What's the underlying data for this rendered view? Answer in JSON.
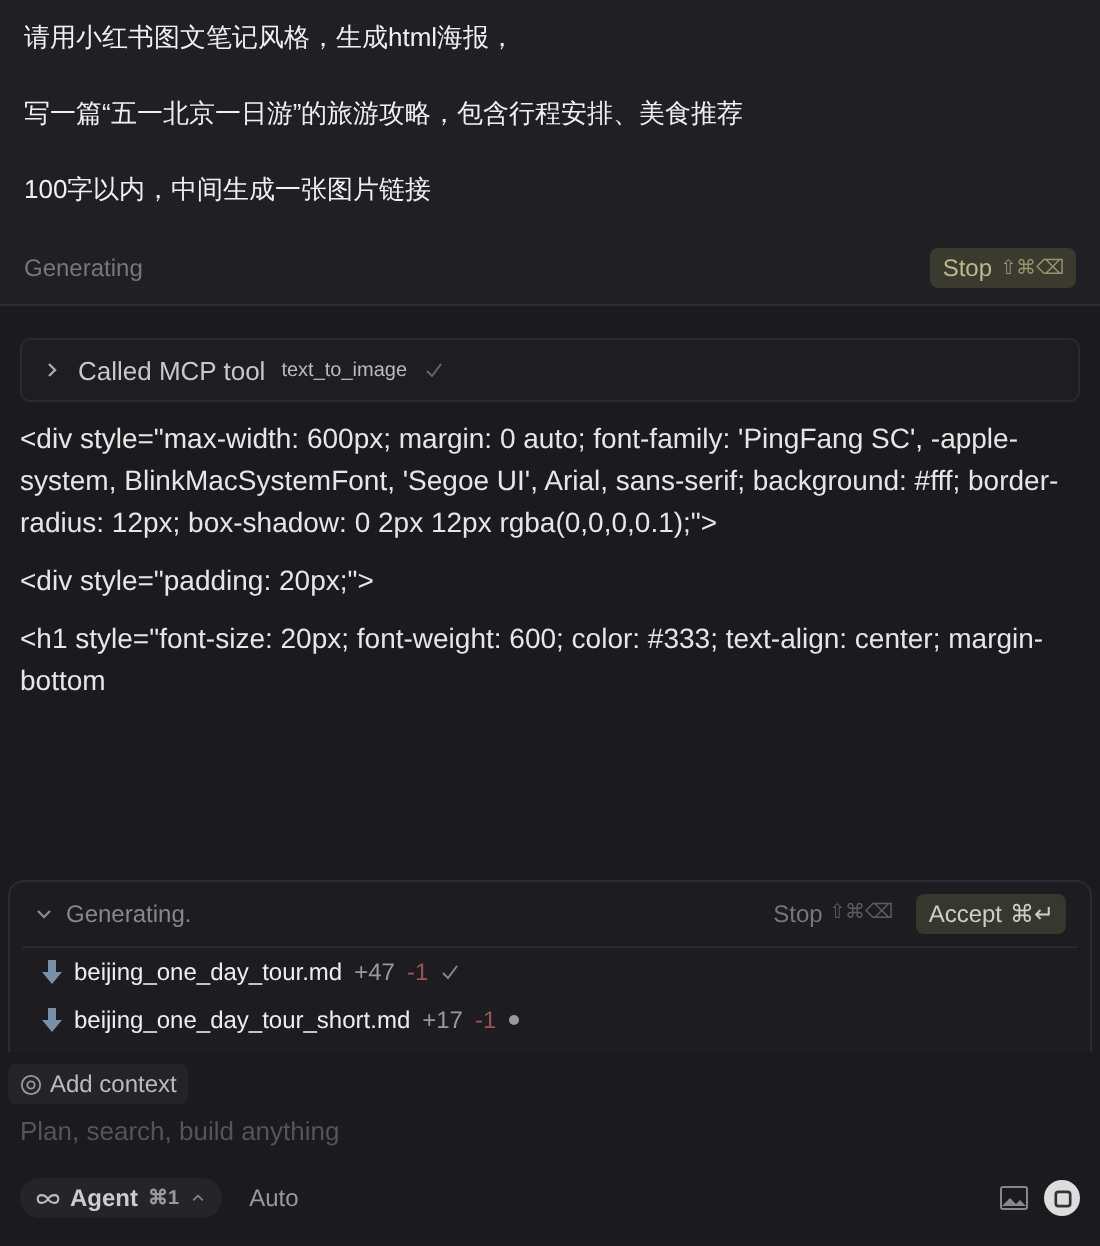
{
  "prompt": {
    "lines": [
      "请用小红书图文笔记风格，生成html海报，",
      "写一篇“五一北京一日游”的旅游攻略，包含行程安排、美食推荐",
      "100字以内，中间生成一张图片链接"
    ],
    "status": "Generating",
    "stop_button": {
      "label": "Stop",
      "shortcut": "⇧⌘⌫"
    }
  },
  "tool_call": {
    "expanded": false,
    "label": "Called MCP tool",
    "tool": "text_to_image",
    "done": true
  },
  "output_paragraphs": [
    "<div style=\"max-width: 600px; margin: 0 auto; font-family: 'PingFang SC', -apple-system, BlinkMacSystemFont, 'Segoe UI', Arial, sans-serif; background: #fff; border-radius: 12px; box-shadow: 0 2px 12px rgba(0,0,0,0.1);\">",
    "<div style=\"padding: 20px;\">",
    "<h1 style=\"font-size: 20px; font-weight: 600; color: #333; text-align: center; margin-bottom"
  ],
  "changes_panel": {
    "expanded": true,
    "status": "Generating.",
    "stop": {
      "label": "Stop",
      "shortcut": "⇧⌘⌫"
    },
    "accept": {
      "label": "Accept",
      "shortcut": "⌘↵"
    },
    "files": [
      {
        "name": "beijing_one_day_tour.md",
        "added": "+47",
        "removed": "-1",
        "done": true
      },
      {
        "name": "beijing_one_day_tour_short.md",
        "added": "+17",
        "removed": "-1",
        "done": false
      }
    ]
  },
  "composer": {
    "add_context": "Add context",
    "placeholder": "Plan, search, build anything",
    "mode": {
      "label": "Agent",
      "shortcut": "⌘1"
    },
    "model": "Auto"
  }
}
